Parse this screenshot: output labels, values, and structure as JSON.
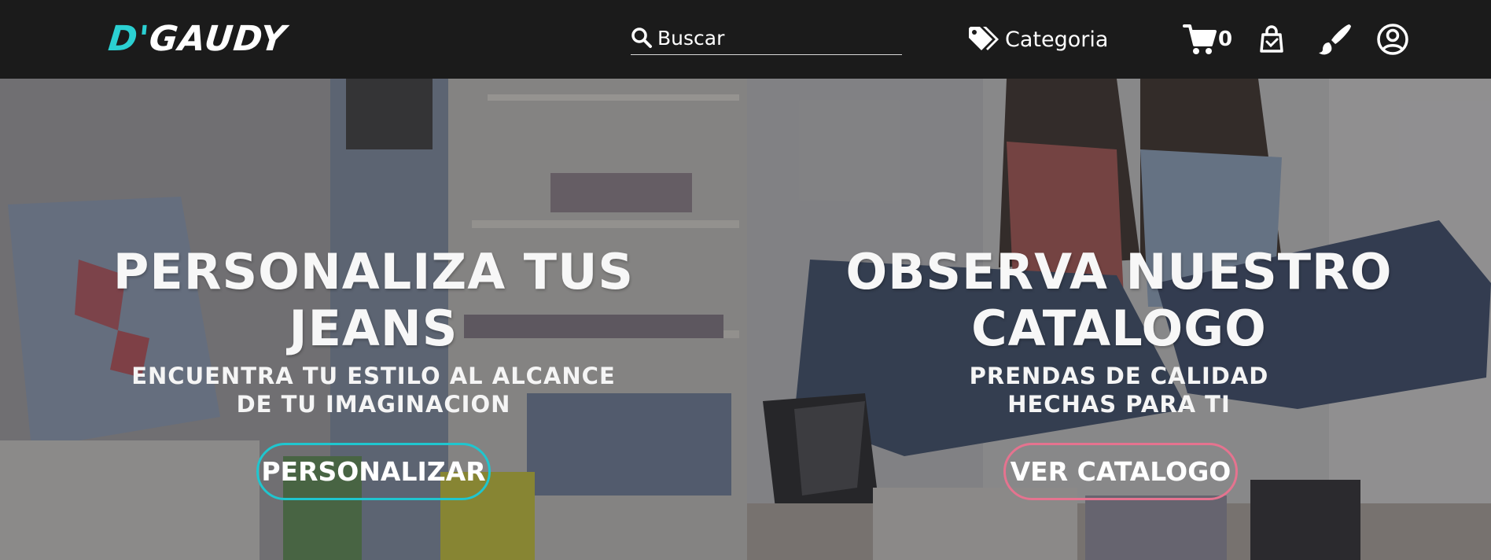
{
  "header": {
    "logo_prefix": "D'",
    "logo_name": "GAUDY",
    "search_placeholder": "Buscar",
    "category_label": "Categoria",
    "cart_count": "0",
    "icons": [
      "search-icon",
      "tags-icon",
      "cart-icon",
      "shopping-bag-icon",
      "paintbrush-icon",
      "user-circle-icon"
    ]
  },
  "hero_left": {
    "title_line1": "PERSONALIZA TUS",
    "title_line2": "JEANS",
    "subtitle_line1": "ENCUENTRA TU ESTILO AL ALCANCE",
    "subtitle_line2": "DE TU IMAGINACION",
    "button_label": "PERSONALIZAR"
  },
  "hero_right": {
    "title_line1": "OBSERVA NUESTRO",
    "title_line2": "CATALOGO",
    "subtitle_line1": "PRENDAS DE CALIDAD",
    "subtitle_line2": "HECHAS PARA TI",
    "button_label": "VER CATALOGO"
  },
  "colors": {
    "header_bg": "#1b1b1b",
    "logo_accent": "#2bd0d2",
    "personalizar_border": "#1fc6cf",
    "catalogo_border": "#e5738f"
  }
}
